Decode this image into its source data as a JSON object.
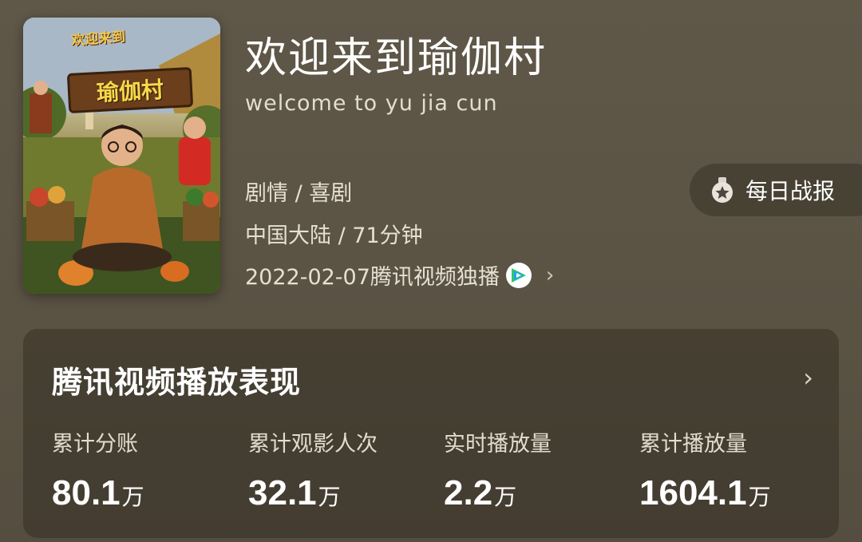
{
  "movie": {
    "title": "欢迎来到瑜伽村",
    "subtitle": "welcome to yu jia cun",
    "genre": "剧情 / 喜剧",
    "region_duration": "中国大陆 / 71分钟",
    "release": "2022-02-07腾讯视频独播",
    "poster": {
      "top_text": "欢迎来到",
      "sign_text": "瑜伽村"
    }
  },
  "daily_report": {
    "label": "每日战报",
    "icon": "medal-star-icon"
  },
  "stats": {
    "title": "腾讯视频播放表现",
    "items": [
      {
        "label": "累计分账",
        "value": "80.1",
        "unit": "万"
      },
      {
        "label": "累计观影人次",
        "value": "32.1",
        "unit": "万"
      },
      {
        "label": "实时播放量",
        "value": "2.2",
        "unit": "万"
      },
      {
        "label": "累计播放量",
        "value": "1604.1",
        "unit": "万"
      }
    ]
  },
  "colors": {
    "background": "#5d5546",
    "card": "#3f382b",
    "tencent_blue": "#1aa7f5",
    "tencent_green": "#35c46a",
    "tencent_orange": "#ff9a1f"
  }
}
